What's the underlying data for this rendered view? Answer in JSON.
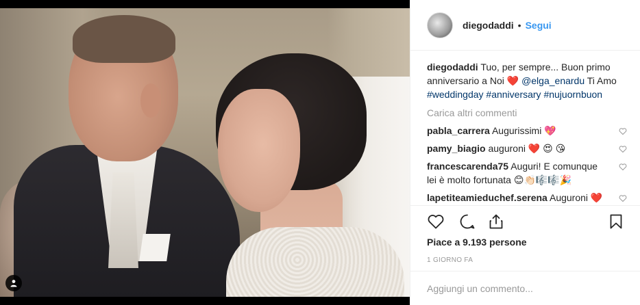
{
  "post": {
    "username": "diegodaddi",
    "separator": "•",
    "follow_label": "Segui",
    "caption": {
      "username": "diegodaddi",
      "text_1": "Tuo, per sempre... Buon primo anniversario a Noi",
      "emoji_heart": "❤️",
      "mention": "@elga_enardu",
      "text_2": "Ti Amo",
      "hashtags": [
        "#weddingday",
        "#anniversary",
        "#nujuornbuon"
      ]
    },
    "load_more_label": "Carica altri commenti",
    "comments": [
      {
        "username": "pabla_carrera",
        "text": "Augurissimi 💖"
      },
      {
        "username": "pamy_biagio",
        "text": "auguroni ❤️ 😍 😘"
      },
      {
        "username": "francescarenda75",
        "text": "Auguri! E comunque lei è molto fortunata 😊👏🏻🎼🎼🎉"
      },
      {
        "username": "lapetiteamieduchef.serena",
        "text": "Auguroni ❤️"
      }
    ],
    "likes_text": "Piace a 9.193 persone",
    "timestamp": "1 GIORNO FA",
    "comment_input_placeholder": "Aggiungi un commento..."
  },
  "icons": {
    "like": "heart-outline-icon",
    "comment": "comment-bubble-icon",
    "share": "share-upload-icon",
    "save": "bookmark-icon",
    "user_tag": "user-tag-icon"
  },
  "colors": {
    "link_blue": "#3897f0",
    "mention_blue": "#003569",
    "text": "#262626",
    "muted": "#999999",
    "heart_red": "#ed4956"
  }
}
